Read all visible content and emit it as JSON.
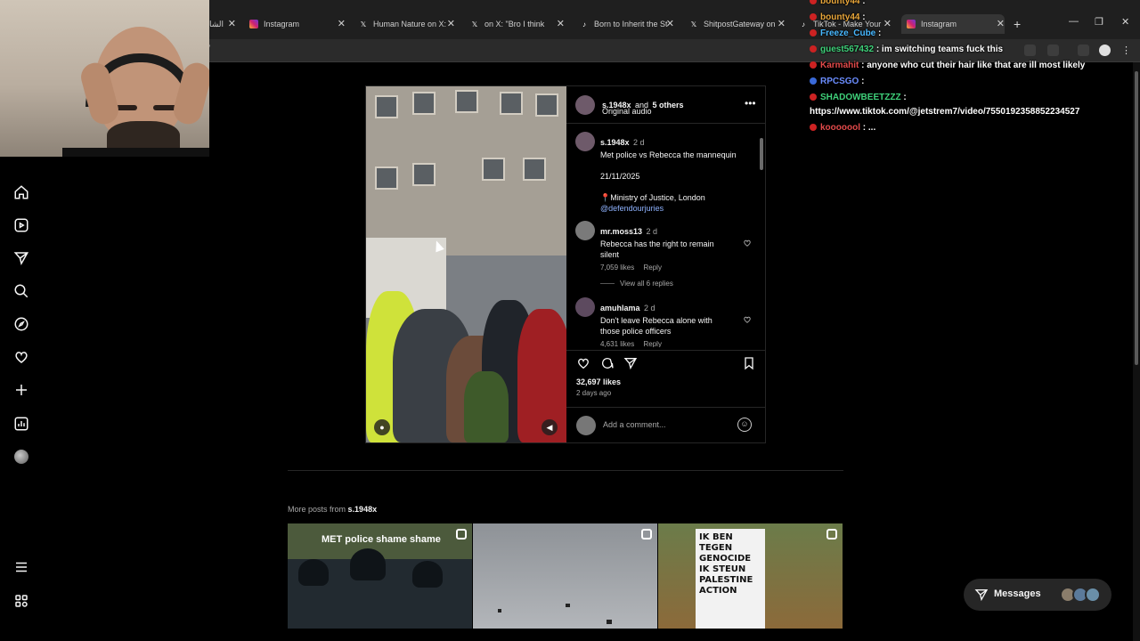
{
  "browser": {
    "tabs": [
      {
        "label": "الشا",
        "icon": "generic-icon"
      },
      {
        "label": "Instagram",
        "icon": "instagram-icon"
      },
      {
        "label": "Human Nature on X:",
        "icon": "x-icon"
      },
      {
        "label": "on X: \"Bro I think",
        "icon": "x-icon"
      },
      {
        "label": "Born to Inherit the St",
        "icon": "tiktok-icon"
      },
      {
        "label": "ShitpostGateway on",
        "icon": "x-icon"
      },
      {
        "label": "TikTok - Make Your",
        "icon": "tiktok-icon"
      },
      {
        "label": "Instagram",
        "icon": "instagram-icon",
        "active": true
      }
    ],
    "address_text": "/"
  },
  "sidebar": {
    "items": [
      "home-icon",
      "reels-icon",
      "messages-icon",
      "search-icon",
      "explore-icon",
      "notifications-icon",
      "create-icon",
      "insights-icon",
      "profile-avatar",
      "menu-icon",
      "threads-icon"
    ]
  },
  "post": {
    "header": {
      "user": "s.1948x",
      "and_others": "and",
      "others_count": "5 others",
      "audio": "Original audio"
    },
    "caption": {
      "user": "s.1948x",
      "time": "2 d",
      "line1": "Met police vs Rebecca the mannequin",
      "date": "21/11/2025",
      "location": "Ministry of Justice, London",
      "mention": "@defendourjuries"
    },
    "comments": [
      {
        "user": "mr.moss13",
        "time": "2 d",
        "text": "Rebecca has the right to remain silent",
        "likes": "7,059 likes",
        "reply": "Reply",
        "view_replies": "View all 6 replies"
      },
      {
        "user": "amuhlama",
        "time": "2 d",
        "text": "Don't leave Rebecca alone with those police officers",
        "likes": "4,631 likes",
        "reply": "Reply"
      }
    ],
    "likes": "32,697 likes",
    "posted": "2 days ago",
    "add_comment_placeholder": "Add a comment..."
  },
  "more_posts": {
    "label_prefix": "More posts from",
    "user": "s.1948x",
    "thumbs": [
      {
        "caption": "MET police shame shame"
      },
      {
        "caption": ""
      },
      {
        "caption": "IK BEN TEGEN GENOCIDE IK STEUN PALESTINE ACTION"
      }
    ]
  },
  "messages": {
    "label": "Messages"
  },
  "chat": [
    {
      "user": "bounty44",
      "text": ":",
      "color": "#e8a63a"
    },
    {
      "user": "bounty44",
      "text": ":",
      "color": "#e8a63a"
    },
    {
      "user": "Freeze_Cube",
      "text": ":",
      "color": "#48b8ff"
    },
    {
      "user": "guest567432",
      "text": ": im switching teams fuck this",
      "color": "#3fd17a"
    },
    {
      "user": "Karmahit",
      "text": ": anyone who cut their hair like that are ill most likely",
      "color": "#e24a4a"
    },
    {
      "user": "RPCSGO",
      "text": ":",
      "color": "#6b8dff"
    },
    {
      "user": "SHADOWBEETZZZ",
      "text": ":",
      "color": "#3fd17a"
    },
    {
      "user": "",
      "text": "https://www.tiktok.com/@jetstrem7/video/7550192358852234527",
      "color": "#ffffff"
    },
    {
      "user": "kooooool",
      "text": ": ...",
      "color": "#e24a4a"
    }
  ],
  "colors": {
    "link": "#e0f1ff",
    "mention": "#8fb3ff",
    "bg": "#000000"
  }
}
